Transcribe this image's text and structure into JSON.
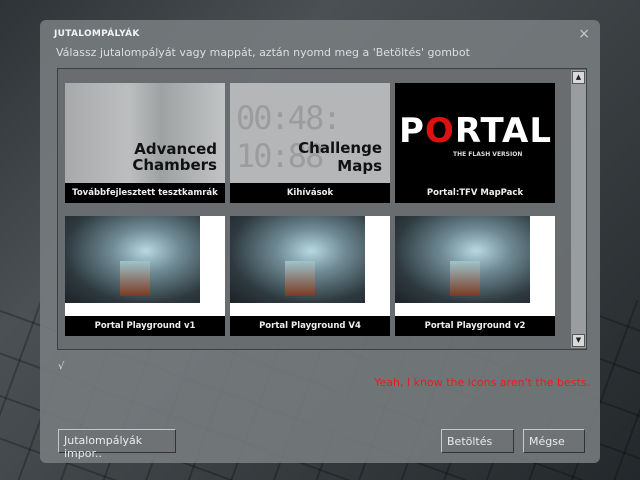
{
  "dialog": {
    "title": "JUTALOMPÁLYÁK",
    "close": "×",
    "subtitle": "Válassz jutalompályát vagy mappát, aztán nyomd meg a 'Betöltés' gombot"
  },
  "maps": [
    {
      "label": "Továbbfejlesztett tesztkamrák",
      "image_text": [
        "Advanced",
        "Chambers"
      ]
    },
    {
      "label": "Kihívások",
      "image_text": [
        "Challenge",
        "Maps"
      ],
      "clock": "00:48: 10:88"
    },
    {
      "label": "Portal:TFV MapPack",
      "image_text": [
        "P",
        "O",
        "RTAL",
        "THE FLASH VERSION"
      ]
    },
    {
      "label": "Portal Playground v1"
    },
    {
      "label": "Portal Playground V4"
    },
    {
      "label": "Portal Playground v2"
    }
  ],
  "scroll": {
    "up": "▲",
    "down": "▼"
  },
  "check": "√",
  "note": "Yeah, I know the icons aren't the bests.",
  "buttons": {
    "import": "Jutalompályák impor..",
    "load": "Betöltés",
    "cancel": "Mégse"
  }
}
